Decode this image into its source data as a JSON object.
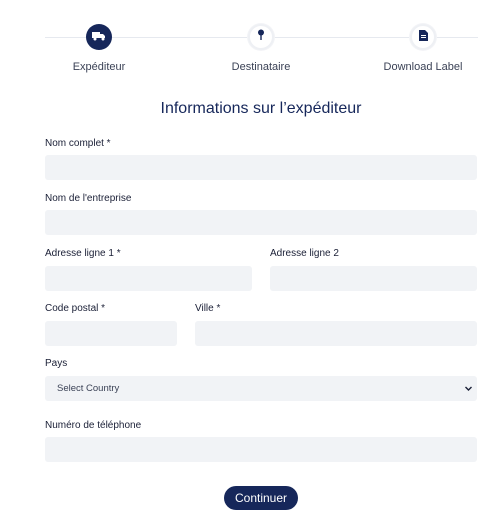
{
  "stepper": {
    "steps": [
      {
        "label": "Expéditeur",
        "icon": "truck-icon",
        "state": "active"
      },
      {
        "label": "Destinataire",
        "icon": "map-pin-icon",
        "state": "inactive"
      },
      {
        "label": "Download Label",
        "icon": "document-icon",
        "state": "inactive"
      }
    ]
  },
  "form": {
    "title": "Informations sur l’expéditeur",
    "full_name": {
      "label": "Nom complet *",
      "value": ""
    },
    "company": {
      "label": "Nom de l'entreprise",
      "value": ""
    },
    "address1": {
      "label": "Adresse ligne 1 *",
      "value": ""
    },
    "address2": {
      "label": "Adresse ligne 2",
      "value": ""
    },
    "postal_code": {
      "label": "Code postal *",
      "value": ""
    },
    "city": {
      "label": "Ville *",
      "value": ""
    },
    "country": {
      "label": "Pays",
      "selected": "Select Country"
    },
    "phone": {
      "label": "Numéro de téléphone",
      "value": ""
    },
    "submit_label": "Continuer"
  },
  "colors": {
    "primary": "#16275a",
    "input_bg": "#f1f3f6"
  }
}
